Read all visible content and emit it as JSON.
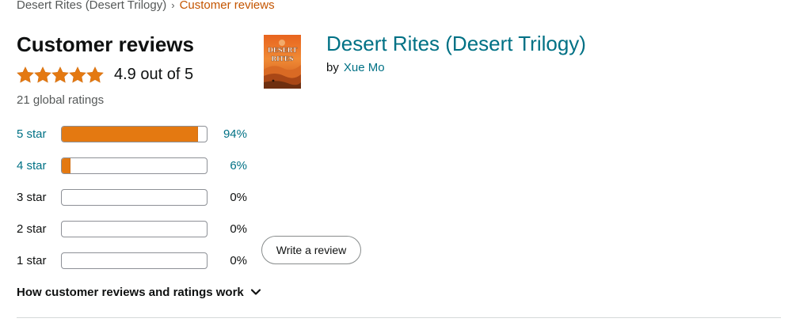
{
  "breadcrumb": {
    "items": [
      "Desert Rites (Desert Trilogy)",
      "Customer reviews"
    ],
    "separator": "›"
  },
  "reviews": {
    "title": "Customer reviews",
    "rating": 4.9,
    "rating_text": "4.9 out of 5",
    "star_count": 5,
    "global_ratings": "21 global ratings",
    "histogram": [
      {
        "label": "5 star",
        "percent": 94,
        "percent_text": "94%",
        "link": true
      },
      {
        "label": "4 star",
        "percent": 6,
        "percent_text": "6%",
        "link": true
      },
      {
        "label": "3 star",
        "percent": 0,
        "percent_text": "0%",
        "link": false
      },
      {
        "label": "2 star",
        "percent": 0,
        "percent_text": "0%",
        "link": false
      },
      {
        "label": "1 star",
        "percent": 0,
        "percent_text": "0%",
        "link": false
      }
    ],
    "how_it_works": "How customer reviews and ratings work"
  },
  "product": {
    "title": "Desert Rites (Desert Trilogy)",
    "by": "by",
    "author": "Xue Mo",
    "cover_text": [
      "DESERT",
      "RITES"
    ]
  },
  "write_review_label": "Write a review",
  "colors": {
    "star": "#e47911",
    "bar_fill": "#e47911",
    "link": "#007185",
    "breadcrumb_current": "#c45500"
  },
  "icons": {
    "star": "star-icon",
    "chevron": "chevron-down-icon"
  }
}
